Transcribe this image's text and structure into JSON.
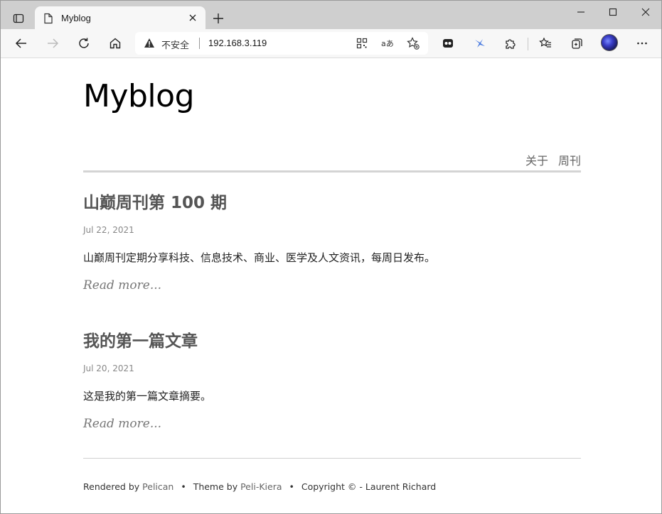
{
  "browser": {
    "tab_title": "Myblog",
    "insecure_label": "不安全",
    "url": "192.168.3.119"
  },
  "site": {
    "title": "Myblog",
    "nav": [
      "关于",
      "周刊"
    ]
  },
  "articles": [
    {
      "title": "山巅周刊第 100 期",
      "date": "Jul 22, 2021",
      "summary": "山巅周刊定期分享科技、信息技术、商业、医学及人文资讯，每周日发布。",
      "read_more": "Read more..."
    },
    {
      "title": "我的第一篇文章",
      "date": "Jul 20, 2021",
      "summary": "这是我的第一篇文章摘要。",
      "read_more": "Read more..."
    }
  ],
  "footer": {
    "rendered_by": "Rendered by",
    "pelican": "Pelican",
    "theme_by": "Theme by",
    "theme": "Peli-Kiera",
    "copyright": "Copyright ©  -  Laurent Richard"
  },
  "icons": {
    "tab_actions": "tab-actions-icon",
    "page": "page-icon",
    "close": "close-icon",
    "plus": "plus-icon",
    "back": "back-arrow-icon",
    "forward": "forward-arrow-icon",
    "refresh": "refresh-icon",
    "home": "home-icon",
    "warning": "warning-icon",
    "qr": "qr-icon",
    "read_aloud": "read-aloud-icon",
    "favorite_add": "star-add-icon",
    "extension": "puzzle-icon",
    "favorites": "favorites-icon",
    "collections": "collections-icon",
    "more": "more-icon"
  }
}
